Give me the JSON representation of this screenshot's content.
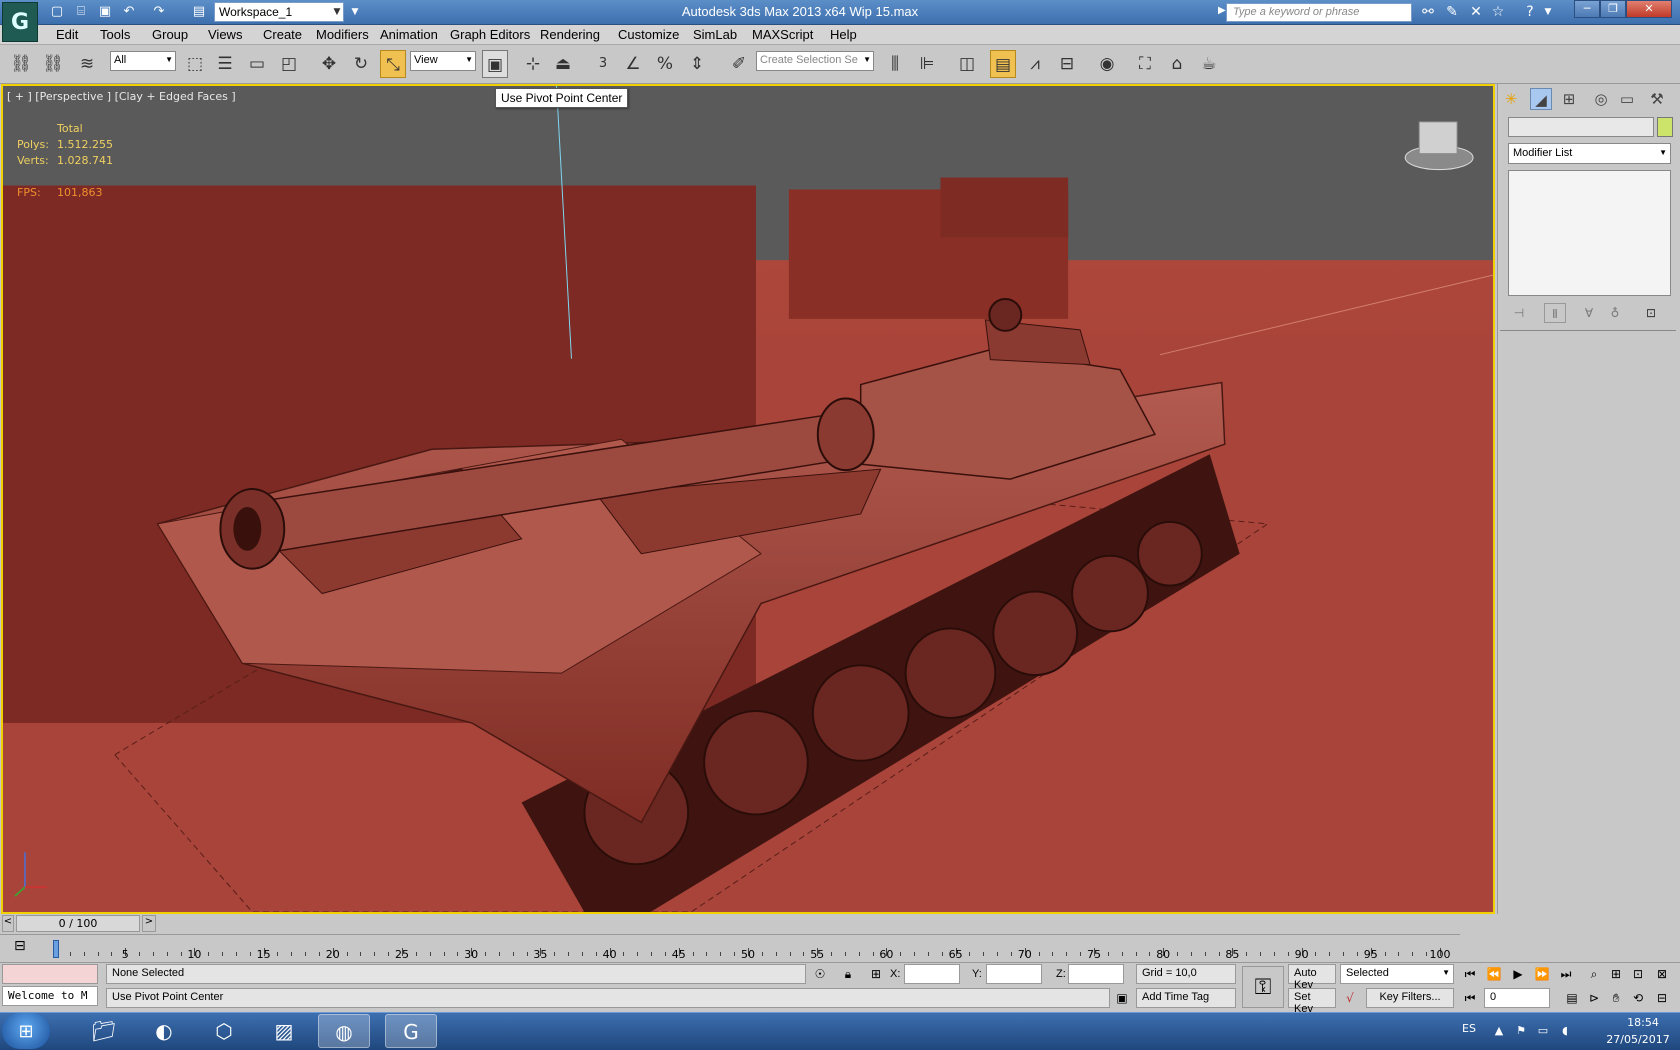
{
  "window": {
    "title": "Autodesk 3ds Max  2013 x64      Wip 15.max",
    "workspace": "Workspace_1",
    "search_placeholder": "Type a keyword or phrase",
    "controls": [
      "minimize",
      "restore",
      "close"
    ]
  },
  "menu": [
    "Edit",
    "Tools",
    "Group",
    "Views",
    "Create",
    "Modifiers",
    "Animation",
    "Graph Editors",
    "Rendering",
    "Customize",
    "SimLab",
    "MAXScript",
    "Help"
  ],
  "toolbar": {
    "selection_filter": "All",
    "reference_coord": "View",
    "named_selection_placeholder": "Create Selection Se",
    "snap_angle": "3",
    "tooltip": "Use Pivot Point Center"
  },
  "viewport": {
    "label": "[ + ] [Perspective ] [Clay + Edged Faces ]",
    "stats_header": "Total",
    "polys_label": "Polys:",
    "polys_value": "1.512.255",
    "verts_label": "Verts:",
    "verts_value": "1.028.741",
    "fps_label": "FPS:",
    "fps_value": "101,863",
    "background_color": "#a84136",
    "border_color": "#f0d000"
  },
  "command_panel": {
    "modifier_list": "Modifier List",
    "object_color": "#cde46a"
  },
  "timeline": {
    "frame_display": "0 / 100",
    "current_frame": 0,
    "range_end": 100,
    "labels": [
      "0",
      "5",
      "10",
      "15",
      "20",
      "25",
      "30",
      "35",
      "40",
      "45",
      "50",
      "55",
      "60",
      "65",
      "70",
      "75",
      "80",
      "85",
      "90",
      "95",
      "100"
    ]
  },
  "status": {
    "maxscript_listener": "Welcome to M",
    "selection": "None Selected",
    "prompt": "Use Pivot Point Center",
    "x_label": "X:",
    "y_label": "Y:",
    "z_label": "Z:",
    "grid": "Grid = 10,0",
    "add_time_tag": "Add Time Tag",
    "auto_key": "Auto Key",
    "set_key": "Set Key",
    "key_mode": "Selected",
    "key_filters": "Key Filters...",
    "frame_spinner": "0"
  },
  "taskbar": {
    "apps": [
      "explorer",
      "firefox",
      "3d-app",
      "image-viewer",
      "globe-app",
      "3ds-max"
    ],
    "language": "ES",
    "time": "18:54",
    "date": "27/05/2017"
  }
}
